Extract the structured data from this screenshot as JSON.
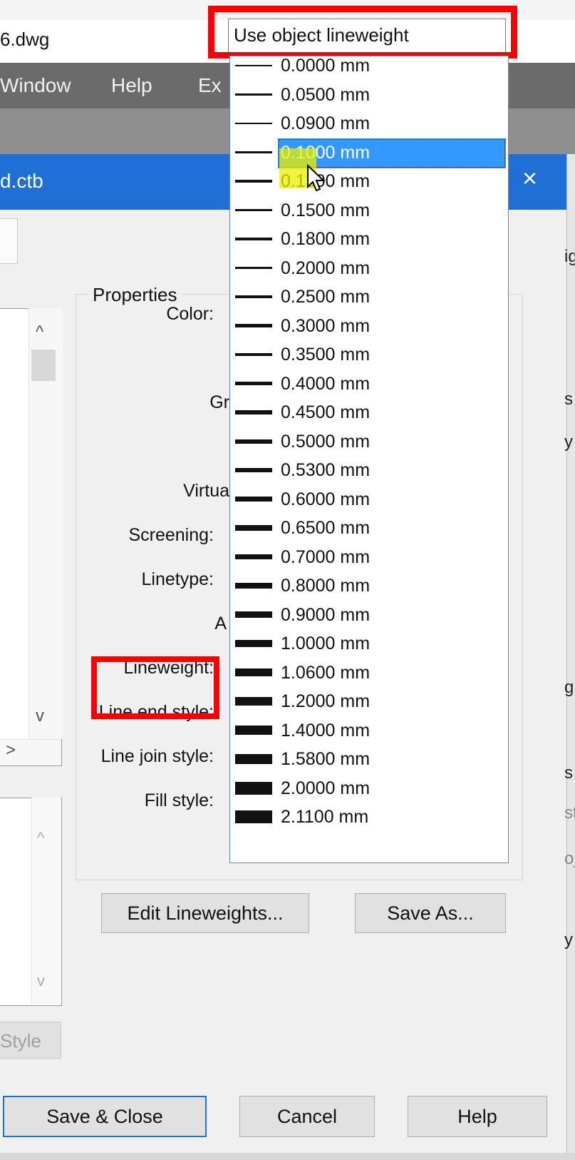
{
  "window": {
    "title": "6.dwg",
    "menu": [
      "Window",
      "Help",
      "Ex"
    ]
  },
  "dialog": {
    "title": "d.ctb",
    "close_icon": "×",
    "properties_label": "Properties",
    "labels": {
      "color": "Color:",
      "grayscale": "Gr",
      "virtual": "Virtua",
      "screening": "Screening:",
      "linetype": "Linetype:",
      "adaptive": "A",
      "lineweight": "Lineweight:",
      "line_end_style": "Line end style:",
      "line_join_style": "Line join style:",
      "fill_style": "Fill style:"
    },
    "buttons": {
      "edit_lineweights": "Edit Lineweights...",
      "save_as": "Save As...",
      "add_style": "Style",
      "save_close": "Save & Close",
      "cancel": "Cancel",
      "help": "Help"
    },
    "scroll_icons": {
      "up": "^",
      "down": "v",
      "right": ">"
    },
    "right_edge_fragments": [
      "ig",
      "s",
      "y",
      "g",
      "s",
      "st",
      "oj",
      "y"
    ]
  },
  "lineweight_dropdown": {
    "current_value": "Use object lineweight",
    "selected_index": 3,
    "options": [
      "0.0000 mm",
      "0.0500 mm",
      "0.0900 mm",
      "0.1000 mm",
      "0.1300 mm",
      "0.1500 mm",
      "0.1800 mm",
      "0.2000 mm",
      "0.2500 mm",
      "0.3000 mm",
      "0.3500 mm",
      "0.4000 mm",
      "0.4500 mm",
      "0.5000 mm",
      "0.5300 mm",
      "0.6000 mm",
      "0.6500 mm",
      "0.7000 mm",
      "0.8000 mm",
      "0.9000 mm",
      "1.0000 mm",
      "1.0600 mm",
      "1.2000 mm",
      "1.4000 mm",
      "1.5800 mm",
      "2.0000 mm",
      "2.1100 mm"
    ]
  },
  "colors": {
    "titlebar": "#1f6fd6",
    "highlight": "#ff0000",
    "selection": "#3399ff"
  }
}
